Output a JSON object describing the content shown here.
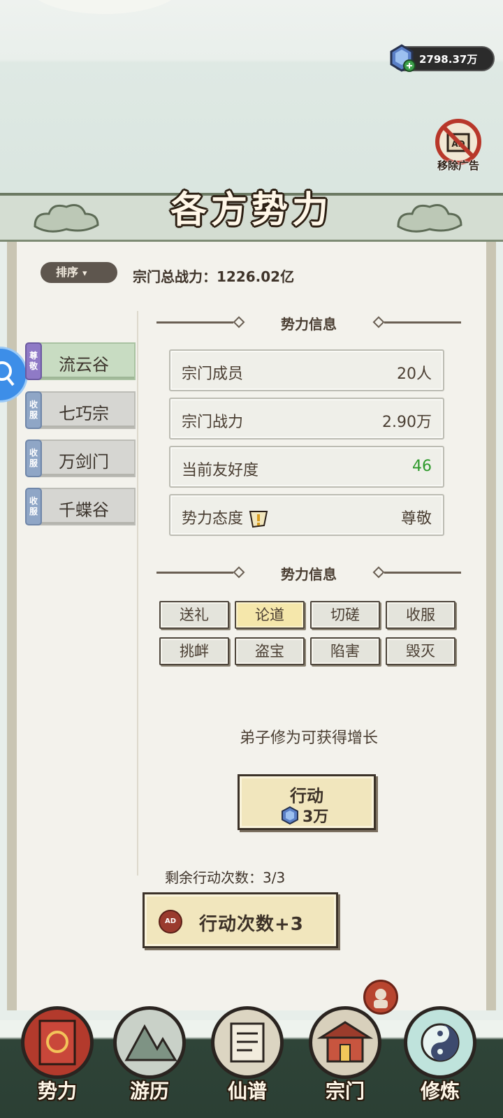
{
  "currency": {
    "amount": "2798.37万"
  },
  "remove_ad": {
    "label": "移除广告"
  },
  "title": "各方势力",
  "sort": {
    "label": "排序"
  },
  "total_power": "宗门总战力：1226.02亿",
  "sects": [
    {
      "badge": "尊敬",
      "name": "流云谷",
      "active": true
    },
    {
      "badge": "收服",
      "name": "七巧宗",
      "active": false
    },
    {
      "badge": "收服",
      "name": "万剑门",
      "active": false
    },
    {
      "badge": "收服",
      "name": "千蝶谷",
      "active": false
    }
  ],
  "info_section": {
    "title": "势力信息"
  },
  "info_rows": [
    {
      "label": "宗门成员",
      "value": "20人"
    },
    {
      "label": "宗门战力",
      "value": "2.90万"
    },
    {
      "label": "当前友好度",
      "value": "46"
    },
    {
      "label": "势力态度",
      "value": "尊敬"
    }
  ],
  "action_section": {
    "title": "势力信息"
  },
  "actions": [
    "送礼",
    "论道",
    "切磋",
    "收服",
    "挑衅",
    "盗宝",
    "陷害",
    "毁灭"
  ],
  "selected_action": "论道",
  "description": "弟子修为可获得增长",
  "go_button": {
    "label": "行动",
    "cost": "3万"
  },
  "remaining": "剩余行动次数：3/3",
  "ad_button": {
    "icon_text": "AD",
    "label": "行动次数+3"
  },
  "nav": [
    {
      "label": "势力",
      "icon": "power-banner-icon"
    },
    {
      "label": "游历",
      "icon": "mountain-travel-icon"
    },
    {
      "label": "仙谱",
      "icon": "scroll-book-icon"
    },
    {
      "label": "宗门",
      "icon": "sect-gate-icon"
    },
    {
      "label": "修炼",
      "icon": "yin-yang-icon"
    }
  ],
  "colors": {
    "friendly_value": "#2f9a2c",
    "selected_action_bg": "#f5e7ab",
    "active_tab_bg": "#c8dcc2"
  }
}
